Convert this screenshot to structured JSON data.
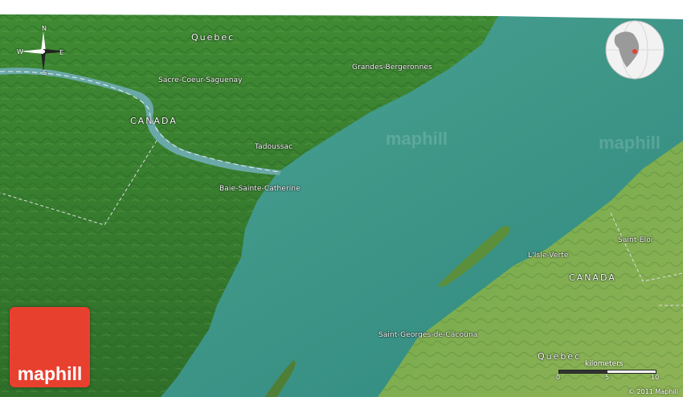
{
  "map": {
    "regions": {
      "quebec_north": "Quebec",
      "canada_west": "CANADA",
      "canada_east": "CANADA",
      "quebec_south": "Quebec"
    },
    "places": {
      "sacre_coeur": "Sacre-Coeur-Saguenay",
      "grandes_bergeronnes": "Grandes-Bergeronnes",
      "tadoussac": "Tadoussac",
      "baie_sainte_catherine": "Baie-Sainte-Catherine",
      "lisle_verte": "L'Isle-Verte",
      "saint_eloi": "Saint-Eloi",
      "saint_georges": "Saint-Georges-de-Cacouna"
    },
    "compass": {
      "n": "N",
      "s": "S",
      "e": "E",
      "w": "W"
    },
    "scale": {
      "unit": "kilometers",
      "ticks": [
        "0",
        "5",
        "10"
      ]
    },
    "brand": "maphill",
    "watermark": "maphill",
    "copyright": "© 2011 Maphill",
    "colors": {
      "land": "#4f8f38",
      "water": "#3f9c8e",
      "logo": "#e8402f"
    }
  }
}
